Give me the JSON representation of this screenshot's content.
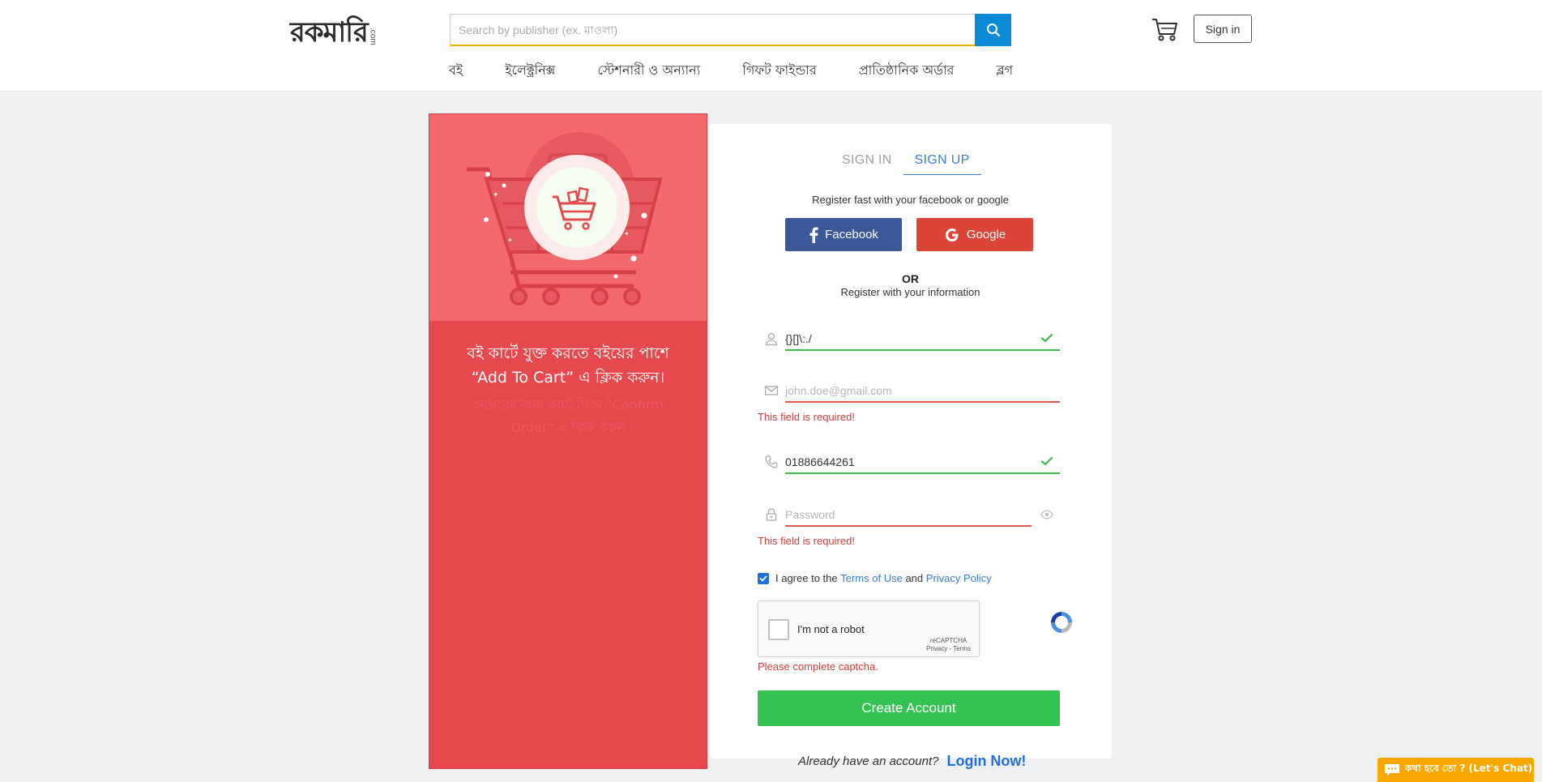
{
  "header": {
    "logo_text": "রকমারি",
    "logo_suffix": ".com",
    "search_placeholder": "Search by publisher (ex. মাওলা)",
    "signin_label": "Sign in"
  },
  "nav": {
    "items": [
      {
        "label": "বই"
      },
      {
        "label": "ইলেক্ট্রনিক্স"
      },
      {
        "label": "স্টেশনারী ও অন্যান্য"
      },
      {
        "label": "গিফট ফাইন্ডার"
      },
      {
        "label": "প্রাতিষ্ঠানিক অর্ডার"
      },
      {
        "label": "ব্লগ"
      }
    ]
  },
  "promo": {
    "title_line1": "বই কার্টে যুক্ত করতে বইয়ের পাশে",
    "title_line2": "“Add To Cart” এ ক্লিক করুন।",
    "subtitle": "অর্ডারের জন্য কার্টে গিয়ে \"Confirm Order\" এ ক্লিক করুন"
  },
  "form": {
    "tabs": [
      {
        "label": "SIGN IN",
        "active": false
      },
      {
        "label": "SIGN UP",
        "active": true
      }
    ],
    "social_caption": "Register fast with your facebook or google",
    "facebook_label": "Facebook",
    "google_label": "Google",
    "or_label": "OR",
    "info_caption": "Register with your information",
    "name": {
      "value": "{}[]\\:./",
      "placeholder": ""
    },
    "email": {
      "value": "",
      "placeholder": "john.doe@gmail.com",
      "error": "This field is required!"
    },
    "phone": {
      "value": "01886644261",
      "placeholder": ""
    },
    "password": {
      "value": "",
      "placeholder": "Password",
      "error": "This field is required!"
    },
    "agree": {
      "prefix": "I agree to the",
      "terms": "Terms of Use",
      "and": "and",
      "privacy": "Privacy Policy",
      "checked": true
    },
    "captcha": {
      "label": "I'm not a robot",
      "brand": "reCAPTCHA",
      "links": "Privacy - Terms",
      "error": "Please complete captcha."
    },
    "submit_label": "Create Account"
  },
  "footer": {
    "already_text": "Already have an account?",
    "login_link": "Login Now!"
  },
  "chat": {
    "label": "কথা হবে তো ? (Let's Chat)"
  },
  "colors": {
    "accent_blue": "#0a8ad6",
    "promo_red": "#e5484d",
    "success_green": "#34c252",
    "error_red": "#d63b3b",
    "facebook": "#3b5998",
    "google": "#dc4437",
    "chat_orange": "#f7a700"
  }
}
